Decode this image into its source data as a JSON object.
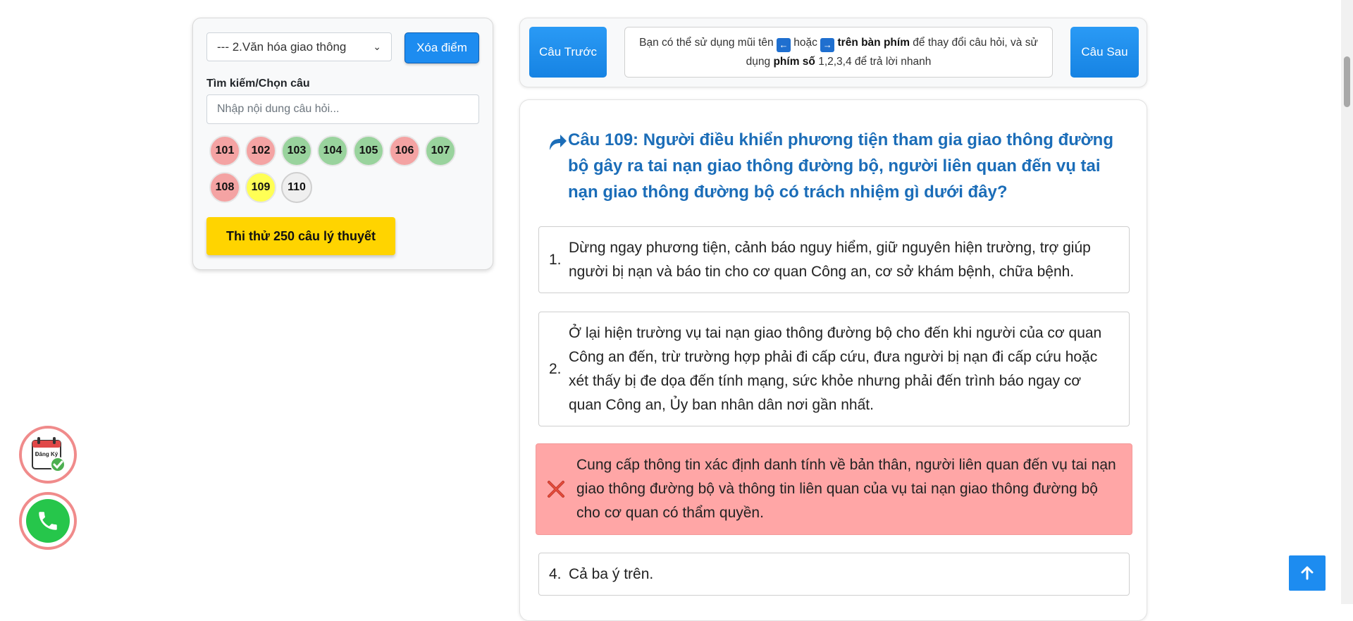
{
  "sidebar": {
    "topic_select_value": "--- 2.Văn hóa giao thông",
    "clear_button": "Xóa điểm",
    "search_label": "Tìm kiếm/Chọn câu",
    "search_placeholder": "Nhập nội dung câu hỏi...",
    "question_bubbles": [
      {
        "label": "101",
        "status": "wrong"
      },
      {
        "label": "102",
        "status": "wrong"
      },
      {
        "label": "103",
        "status": "correct"
      },
      {
        "label": "104",
        "status": "correct"
      },
      {
        "label": "105",
        "status": "correct"
      },
      {
        "label": "106",
        "status": "wrong"
      },
      {
        "label": "107",
        "status": "correct"
      },
      {
        "label": "108",
        "status": "wrong"
      },
      {
        "label": "109",
        "status": "current"
      },
      {
        "label": "110",
        "status": "unanswered"
      }
    ],
    "exam_button": "Thi thử 250 câu lý thuyết"
  },
  "nav": {
    "prev_button": "Câu Trước",
    "next_button": "Câu Sau",
    "hint_part1": "Bạn có thể sử dụng mũi tên",
    "hint_left_key": "←",
    "hint_or": "hoặc",
    "hint_right_key": "→",
    "hint_keyboard": "trên bàn phím",
    "hint_part2": "để thay đổi câu hỏi, và sử dụng",
    "hint_numkeys": "phím số",
    "hint_part3": "1,2,3,4 để trả lời nhanh"
  },
  "question": {
    "title": "Câu 109: Người điều khiển phương tiện tham gia giao thông đường bộ gây ra tai nạn giao thông đường bộ, người liên quan đến vụ tai nạn giao thông đường bộ có trách nhiệm gì dưới đây?",
    "answers": [
      {
        "num": "1.",
        "text": "Dừng ngay phương tiện, cảnh báo nguy hiểm, giữ nguyên hiện trường, trợ giúp người bị nạn và báo tin cho cơ quan Công an, cơ sở khám bệnh, chữa bệnh."
      },
      {
        "num": "2.",
        "text": "Ở lại hiện trường vụ tai nạn giao thông đường bộ cho đến khi người của cơ quan Công an đến, trừ trường hợp phải đi cấp cứu, đưa người bị nạn đi cấp cứu hoặc xét thấy bị đe dọa đến tính mạng, sức khỏe nhưng phải đến trình báo ngay cơ quan Công an, Ủy ban nhân dân nơi gần nhất."
      },
      {
        "num": "",
        "text": "Cung cấp thông tin xác định danh tính về bản thân, người liên quan đến vụ tai nạn giao thông đường bộ và thông tin liên quan của vụ tai nạn giao thông đường bộ cho cơ quan có thẩm quyền.",
        "state": "wrong"
      },
      {
        "num": "4.",
        "text": "Cả ba ý trên."
      }
    ]
  },
  "widgets": {
    "register_icon_text": "Đăng Ký"
  },
  "colors": {
    "primary_blue": "#1d8cf0",
    "title_blue": "#1b6db8",
    "wrong_red": "#ffa6a6",
    "correct_green": "#99d39d",
    "current_yellow": "#ffff55",
    "exam_yellow": "#ffd400"
  }
}
